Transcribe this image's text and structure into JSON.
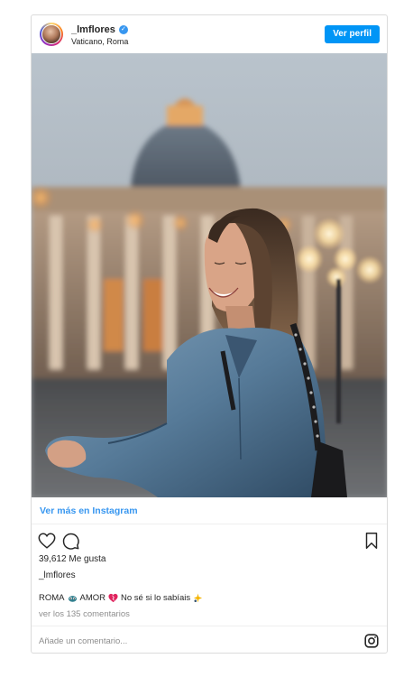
{
  "header": {
    "username": "_lmflores",
    "verified_mark": "✓",
    "location": "Vaticano, Roma",
    "profile_button": "Ver perfil"
  },
  "view_more": "Ver más en Instagram",
  "likes_text": "39,612 Me gusta",
  "owner": "_lmflores",
  "caption": {
    "part1": "ROMA",
    "part2": "AMOR",
    "part3": "No sé si lo sabíais"
  },
  "comments_link": "ver los 135 comentarios",
  "comment_placeholder": "Añade un comentario...",
  "colors": {
    "accent": "#3897f0",
    "button": "#0095f6",
    "text": "#262626",
    "muted": "#8e8e8e",
    "border": "#dbdbdb"
  },
  "icons": [
    "verified-icon",
    "heart-icon",
    "comment-icon",
    "bookmark-icon",
    "eye-emoji-icon",
    "heart-emoji-icon",
    "sparkle-emoji-icon",
    "instagram-icon"
  ]
}
